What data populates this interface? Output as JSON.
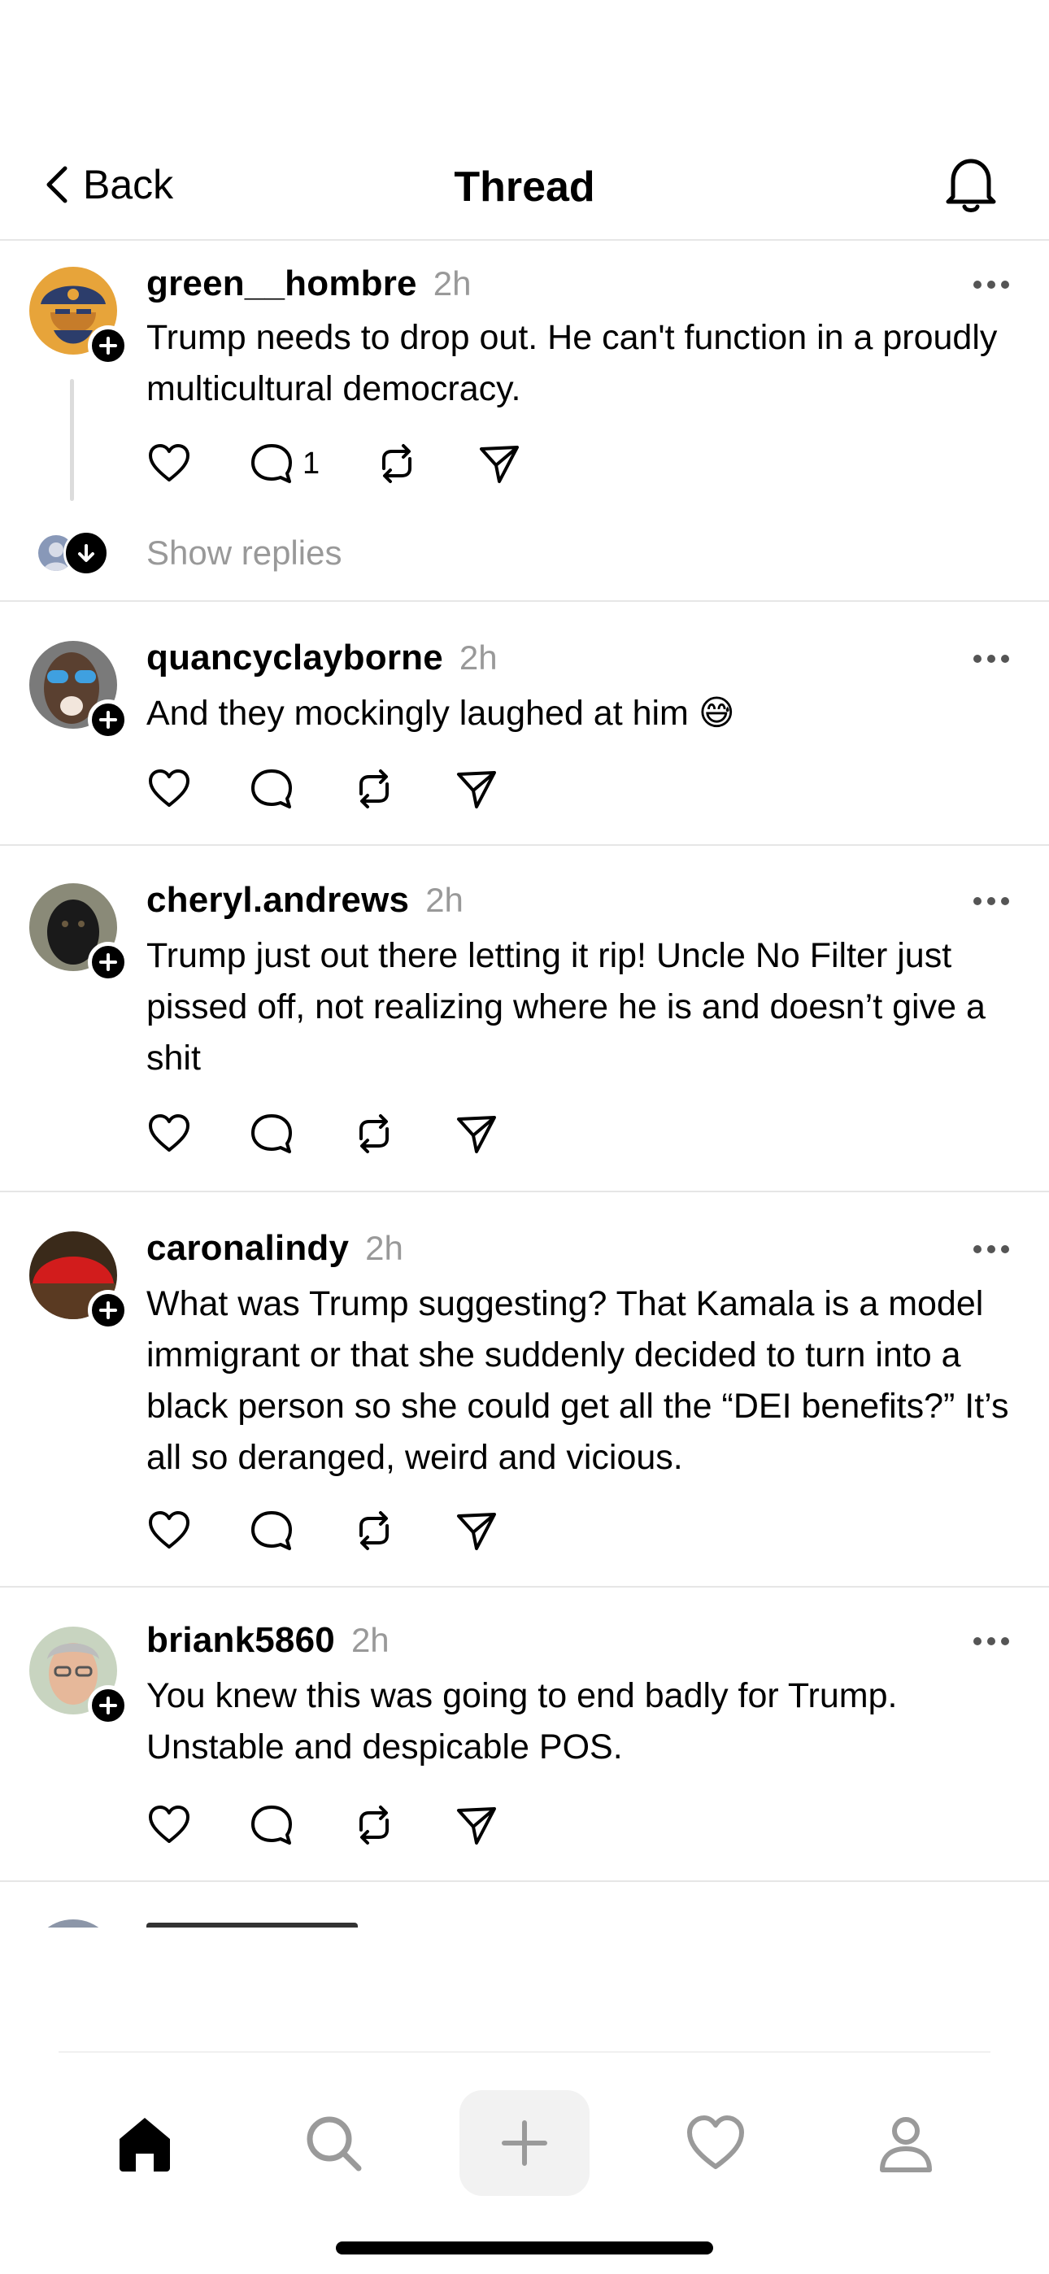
{
  "header": {
    "back_label": "Back",
    "title": "Thread",
    "icons": {
      "back": "chevron-left-icon",
      "notifications": "bell-icon"
    }
  },
  "posts": [
    {
      "username": "green__hombre",
      "time": "2h",
      "text": "Trump needs to drop out. He can't function in a proudly multicultural democracy.",
      "reply_count": "1",
      "avatar_colors": [
        "#e7a43a",
        "#2c3d6b"
      ]
    },
    {
      "username": "quancyclayborne",
      "time": "2h",
      "text": "And they mockingly laughed at him 😅",
      "reply_count": "",
      "avatar_colors": [
        "#5a4030",
        "#3fa0e0"
      ]
    },
    {
      "username": "cheryl.andrews",
      "time": "2h",
      "text": "Trump just out there letting it rip! Uncle No Filter just pissed off, not realizing where he is and doesn’t give a shit",
      "reply_count": "",
      "avatar_colors": [
        "#8a8a78",
        "#1a1a1a"
      ]
    },
    {
      "username": "caronalindy",
      "time": "2h",
      "text": "What was Trump suggesting? That Kamala is a model immigrant or that she suddenly decided to turn into a black person so she could get all the “DEI benefits?” It’s all so deranged, weird and vicious.",
      "reply_count": "",
      "avatar_colors": [
        "#d21c1c",
        "#3a2a1a"
      ]
    },
    {
      "username": "briank5860",
      "time": "2h",
      "text": "You knew this was going to end badly for Trump. Unstable and despicable POS.",
      "reply_count": "",
      "avatar_colors": [
        "#c8d4c0",
        "#e6b89a"
      ]
    }
  ],
  "thread": {
    "show_replies_label": "Show replies"
  },
  "nav": {
    "items": [
      "home-icon",
      "search-icon",
      "compose-plus-icon",
      "heart-icon",
      "profile-icon"
    ]
  },
  "colors": {
    "text": "#000000",
    "muted": "#999999",
    "divider": "#e6e6e6"
  }
}
